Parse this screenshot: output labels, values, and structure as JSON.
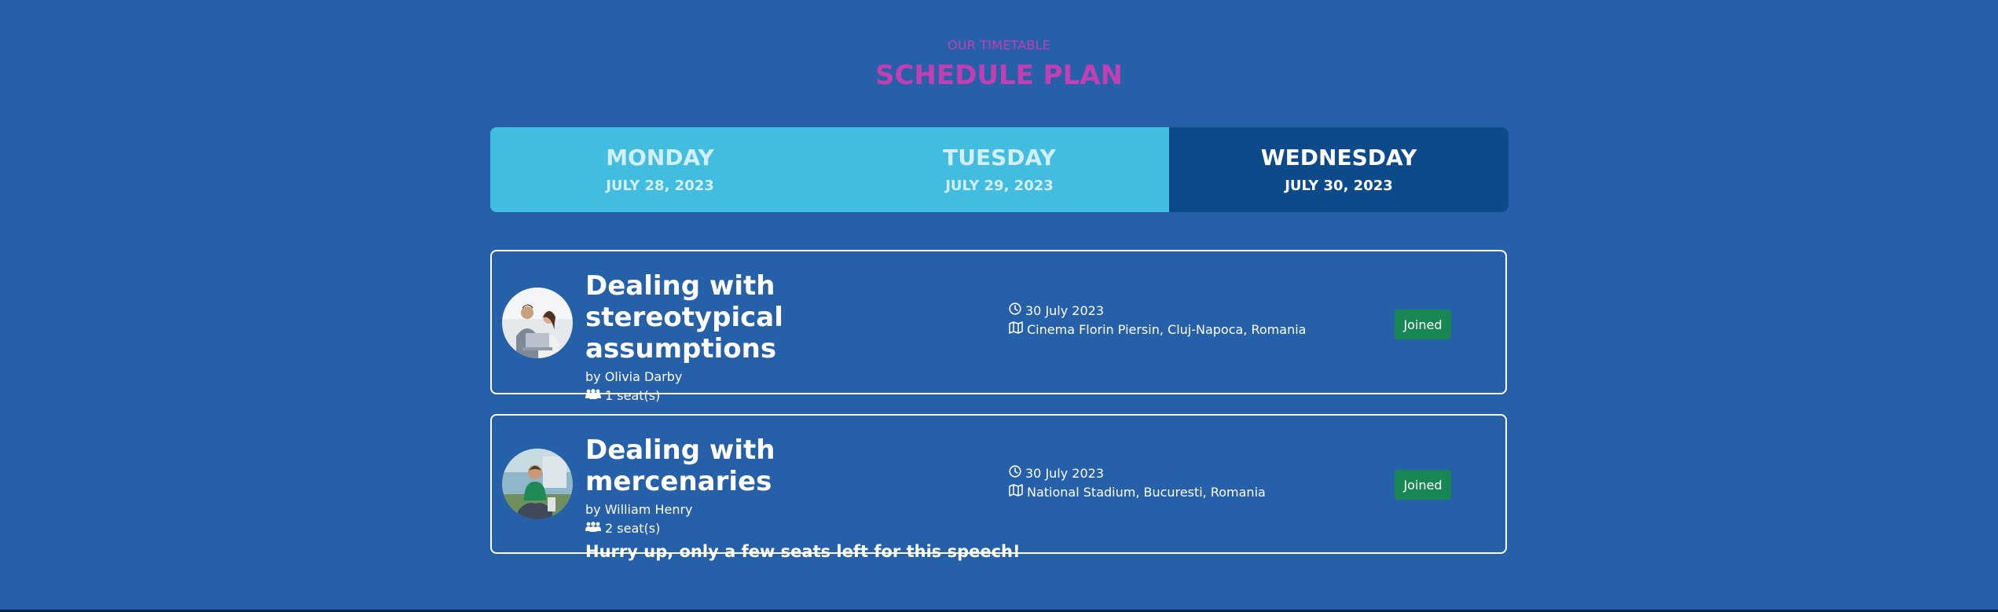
{
  "header": {
    "subtitle": "OUR TIMETABLE",
    "title": "SCHEDULE PLAN"
  },
  "tabs": [
    {
      "day": "MONDAY",
      "date": "JULY 28, 2023",
      "active": false
    },
    {
      "day": "TUESDAY",
      "date": "JULY 29, 2023",
      "active": false
    },
    {
      "day": "WEDNESDAY",
      "date": "JULY 30, 2023",
      "active": true
    }
  ],
  "speeches": [
    {
      "title": "Dealing with stereotypical assumptions",
      "speaker": "by Olivia Darby",
      "seats": "1 seat(s)",
      "date": "30 July 2023",
      "location": "Cinema Florin Piersin, Cluj-Napoca, Romania",
      "status": "Joined",
      "warning": ""
    },
    {
      "title": "Dealing with mercenaries",
      "speaker": "by William Henry",
      "seats": "2 seat(s)",
      "date": "30 July 2023",
      "location": "National Stadium, Bucuresti, Romania",
      "status": "Joined",
      "warning": "Hurry up, only a few seats left for this speech!"
    }
  ],
  "icons": {
    "seats": "people-icon",
    "date": "clock-icon",
    "location": "map-icon"
  },
  "colors": {
    "background": "#2660a8",
    "accent": "#c13fb2",
    "tab_bar": "#43bddf",
    "tab_active": "#0d4a8a",
    "joined_badge": "#198754"
  }
}
